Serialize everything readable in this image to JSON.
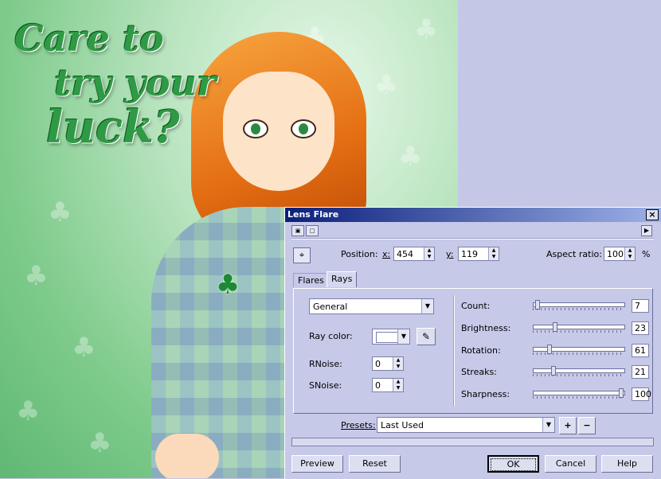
{
  "canvas": {
    "headline_lines": [
      "Care to",
      "try your",
      "luck?"
    ],
    "pendant_icon": "clover-pendant",
    "colors": {
      "background": "#8fd19a",
      "hair": "#ef8a24",
      "headline": "#2f9a45"
    }
  },
  "dialog": {
    "title": "Lens Flare",
    "close_glyph": "×",
    "position_label": "Position:",
    "x_label": "x:",
    "x_value": "454",
    "y_label": "y:",
    "y_value": "119",
    "aspect_label": "Aspect ratio:",
    "aspect_value": "100",
    "aspect_unit": "%",
    "tabs": [
      {
        "label": "Flares"
      },
      {
        "label": "Rays"
      }
    ],
    "active_tab": "Rays",
    "type_value": "General",
    "ray_color_label": "Ray color:",
    "rnoise_label": "RNoise:",
    "rnoise_value": "0",
    "snoise_label": "SNoise:",
    "snoise_value": "0",
    "sliders": [
      {
        "label": "Count:",
        "value": "7",
        "fraction": 0.03
      },
      {
        "label": "Brightness:",
        "value": "23",
        "fraction": 0.23
      },
      {
        "label": "Rotation:",
        "value": "61",
        "fraction": 0.17
      },
      {
        "label": "Streaks:",
        "value": "21",
        "fraction": 0.21
      },
      {
        "label": "Sharpness:",
        "value": "100",
        "fraction": 1.0
      }
    ],
    "presets_label": "Presets:",
    "presets_value": "Last Used",
    "preset_add": "+",
    "preset_remove": "−",
    "buttons": {
      "preview": "Preview",
      "reset": "Reset",
      "ok": "OK",
      "cancel": "Cancel",
      "help": "Help"
    },
    "colors": {
      "title_start": "#0a1f7a",
      "title_end": "#9db2e8",
      "face": "#c6c9e8"
    }
  }
}
